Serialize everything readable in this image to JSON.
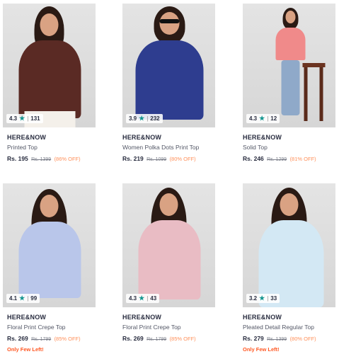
{
  "products": [
    {
      "rating": "4.3",
      "rating_count": "131",
      "brand": "HERE&NOW",
      "name": "Printed Top",
      "price": "Rs. 195",
      "mrp": "Rs. 1399",
      "discount": "(86% OFF)",
      "stock_note": "",
      "top_color": "#5a2a24"
    },
    {
      "rating": "3.9",
      "rating_count": "232",
      "brand": "HERE&NOW",
      "name": "Women Polka Dots Print Top",
      "price": "Rs. 219",
      "mrp": "Rs. 1099",
      "discount": "(80% OFF)",
      "stock_note": "",
      "top_color": "#2e3d8f"
    },
    {
      "rating": "4.3",
      "rating_count": "12",
      "brand": "HERE&NOW",
      "name": "Solid Top",
      "price": "Rs. 246",
      "mrp": "Rs. 1299",
      "discount": "(81% OFF)",
      "stock_note": "",
      "top_color": "#f08a8a"
    },
    {
      "rating": "4.1",
      "rating_count": "99",
      "brand": "HERE&NOW",
      "name": "Floral Print Crepe Top",
      "price": "Rs. 269",
      "mrp": "Rs. 1799",
      "discount": "(85% OFF)",
      "stock_note": "Only Few Left!",
      "top_color": "#b9c6ea"
    },
    {
      "rating": "4.3",
      "rating_count": "43",
      "brand": "HERE&NOW",
      "name": "Floral Print Crepe Top",
      "price": "Rs. 269",
      "mrp": "Rs. 1799",
      "discount": "(85% OFF)",
      "stock_note": "",
      "top_color": "#e9bcc4"
    },
    {
      "rating": "3.2",
      "rating_count": "33",
      "brand": "HERE&NOW",
      "name": "Pleated Detail Regular Top",
      "price": "Rs. 279",
      "mrp": "Rs. 1399",
      "discount": "(80% OFF)",
      "stock_note": "Only Few Left!",
      "top_color": "#d3e8f4"
    }
  ],
  "icons": {
    "rating_star": "star-icon"
  }
}
